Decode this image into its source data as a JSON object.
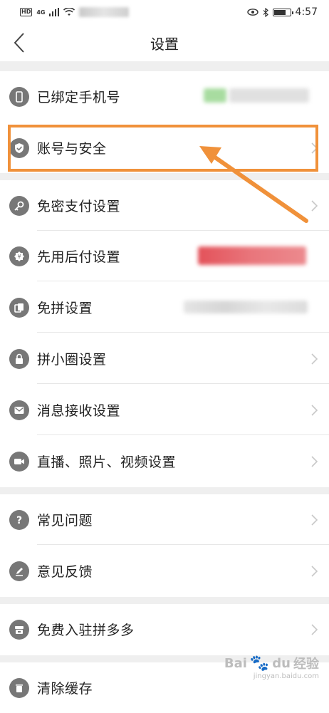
{
  "status_bar": {
    "hd": "HD",
    "signal": "4G",
    "time": "4:57"
  },
  "nav": {
    "title": "设置"
  },
  "rows": [
    {
      "label": "已绑定手机号",
      "icon": "phone-icon"
    },
    {
      "label": "账号与安全",
      "icon": "shield-icon"
    },
    {
      "label": "免密支付设置",
      "icon": "key-icon"
    },
    {
      "label": "先用后付设置",
      "icon": "pay-later-icon"
    },
    {
      "label": "免拼设置",
      "icon": "pin-free-icon"
    },
    {
      "label": "拼小圈设置",
      "icon": "lock-icon"
    },
    {
      "label": "消息接收设置",
      "icon": "message-icon"
    },
    {
      "label": "直播、照片、视频设置",
      "icon": "video-icon"
    },
    {
      "label": "常见问题",
      "icon": "question-icon"
    },
    {
      "label": "意见反馈",
      "icon": "edit-icon"
    },
    {
      "label": "免费入驻拼多多",
      "icon": "store-icon"
    },
    {
      "label": "清除缓存",
      "icon": "clear-cache-icon"
    }
  ],
  "watermark": {
    "brand": "Bai",
    "paw": "du",
    "suffix": "经验",
    "site": "jingyan.baidu.com"
  },
  "colors": {
    "highlight": "#f0913a",
    "icon_gray": "#777777",
    "section_gap": "#efefef"
  }
}
